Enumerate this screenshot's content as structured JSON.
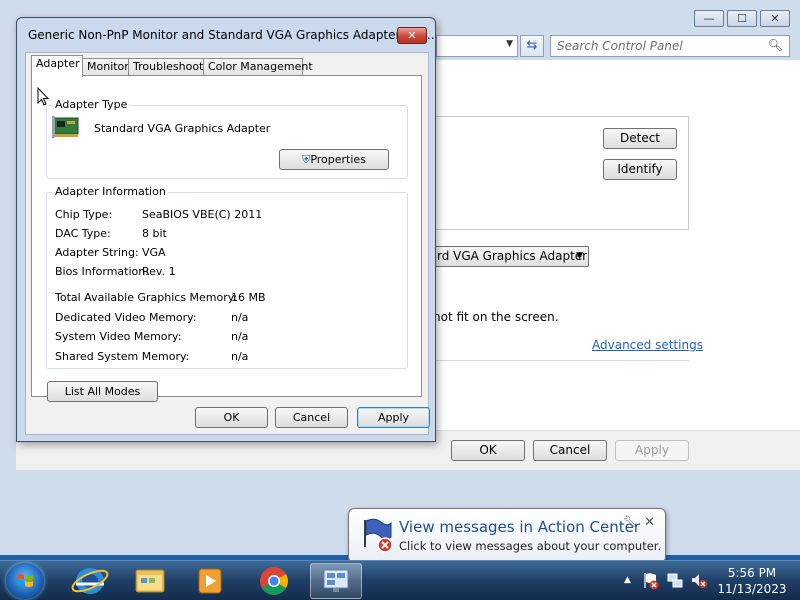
{
  "background_window": {
    "controls": [
      "—",
      "☐",
      "✕"
    ],
    "search_placeholder": "Search Control Panel",
    "detect_label": "Detect",
    "identify_label": "Identify",
    "adapter_select_text": "rd VGA Graphics Adapter",
    "fit_text": "not fit on the screen.",
    "advanced_link": "Advanced settings",
    "ok_label": "OK",
    "cancel_label": "Cancel",
    "apply_label": "Apply"
  },
  "dialog": {
    "title": "Generic Non-PnP Monitor and Standard VGA Graphics Adapter Pro...",
    "close_glyph": "✕",
    "tabs": [
      {
        "label": "Adapter"
      },
      {
        "label": "Monitor"
      },
      {
        "label": "Troubleshoot"
      },
      {
        "label": "Color Management"
      }
    ],
    "adapter_type_label": "Adapter Type",
    "adapter_name": "Standard VGA Graphics Adapter",
    "properties_label": "Properties",
    "adapter_info_label": "Adapter Information",
    "info": [
      {
        "key": "Chip Type:",
        "value": "SeaBIOS VBE(C) 2011"
      },
      {
        "key": "DAC Type:",
        "value": "8 bit"
      },
      {
        "key": "Adapter String:",
        "value": "VGA"
      },
      {
        "key": "Bios Information:",
        "value": "Rev. 1"
      }
    ],
    "memory": [
      {
        "key": "Total Available Graphics Memory:",
        "value": "16 MB"
      },
      {
        "key": "Dedicated Video Memory:",
        "value": "n/a"
      },
      {
        "key": "System Video Memory:",
        "value": "n/a"
      },
      {
        "key": "Shared System Memory:",
        "value": "n/a"
      }
    ],
    "list_modes_label": "List All Modes",
    "ok_label": "OK",
    "cancel_label": "Cancel",
    "apply_label": "Apply"
  },
  "notification": {
    "title": "View messages in Action Center",
    "body": "Click to view messages about your computer.",
    "close_glyph": "✕"
  },
  "taskbar": {
    "time": "5:56 PM",
    "date": "11/13/2023",
    "tray_arrow": "▲"
  },
  "colors": {
    "accent": "#1e4f93",
    "link": "#1f63c7",
    "close_red": "#c84634"
  }
}
